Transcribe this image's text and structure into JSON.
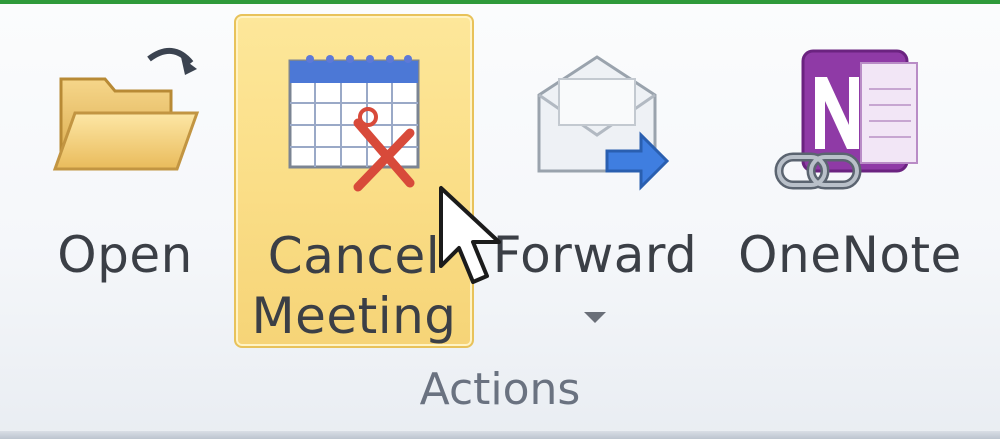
{
  "ribbon": {
    "group_label": "Actions",
    "accent_color": "#2f9a3a",
    "hover_color": "#fbe08b",
    "buttons": {
      "open": {
        "label": "Open",
        "icon": "folder-open-icon"
      },
      "cancel_meeting": {
        "label_line1": "Cancel",
        "label_line2": "Meeting",
        "icon": "calendar-cancel-icon",
        "state": "hovered"
      },
      "forward": {
        "label": "Forward",
        "icon": "envelope-forward-icon",
        "has_dropdown": true
      },
      "onenote": {
        "label": "OneNote",
        "icon": "onenote-link-icon"
      }
    }
  }
}
